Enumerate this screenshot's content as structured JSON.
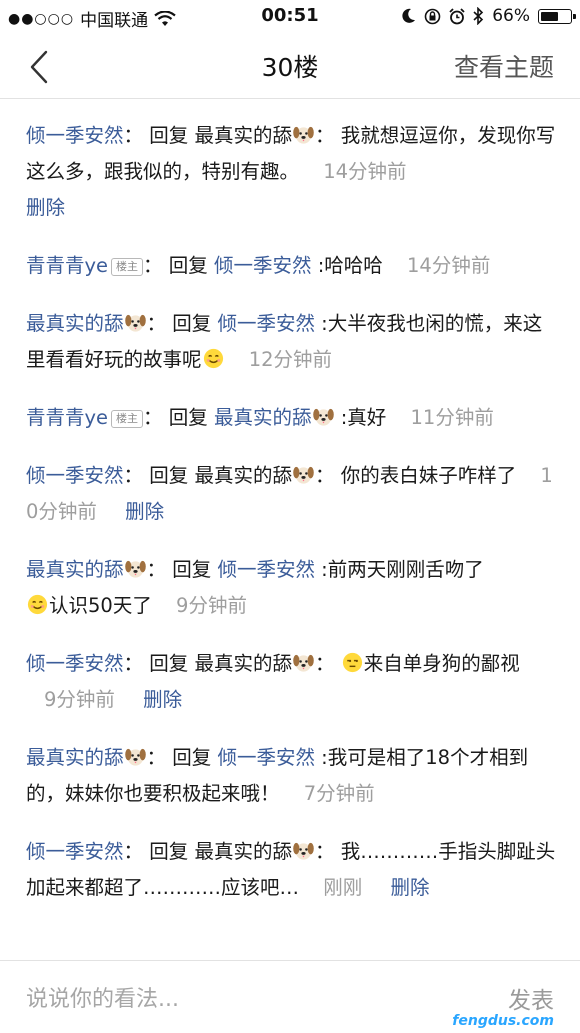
{
  "status_bar": {
    "signal": "●●○○○",
    "carrier": "中国联通",
    "time": "00:51",
    "battery": "66%",
    "battery_level": 0.66
  },
  "nav": {
    "title": "30楼",
    "action": "查看主题"
  },
  "comments": [
    {
      "name": "倾一季安然",
      "name_emoji": "",
      "badge": "",
      "reply_word": "回复",
      "target": "最真实的舔",
      "target_emoji": "dog-face",
      "colon": "：",
      "text": "我就想逗逗你，发现你写这么多，跟我似的，特别有趣。",
      "text_emoji": "",
      "time": "14分钟前",
      "delete": "删除"
    },
    {
      "name": "青青青ye",
      "name_emoji": "",
      "badge": "楼主",
      "reply_word": "回复",
      "target": "倾一季安然",
      "target_emoji": "",
      "colon": ":",
      "text": "哈哈哈",
      "text_emoji": "",
      "time": "14分钟前",
      "delete": ""
    },
    {
      "name": "最真实的舔",
      "name_emoji": "dog-face",
      "badge": "",
      "reply_word": "回复",
      "target": "倾一季安然",
      "target_emoji": "",
      "colon": ":",
      "text": "大半夜我也闲的慌，来这里看看好玩的故事呢",
      "text_emoji": "smiling-face",
      "time": "12分钟前",
      "delete": ""
    },
    {
      "name": "青青青ye",
      "name_emoji": "",
      "badge": "楼主",
      "reply_word": "回复",
      "target": "最真实的舔",
      "target_emoji": "dog-face",
      "colon": ":",
      "text": "真好",
      "text_emoji": "",
      "time": "11分钟前",
      "delete": ""
    },
    {
      "name": "倾一季安然",
      "name_emoji": "",
      "badge": "",
      "reply_word": "回复",
      "target": "最真实的舔",
      "target_emoji": "dog-face",
      "colon": "：",
      "text": "你的表白妹子咋样了",
      "text_emoji": "",
      "time": "10分钟前",
      "delete": "删除"
    },
    {
      "name": "最真实的舔",
      "name_emoji": "dog-face",
      "badge": "",
      "reply_word": "回复",
      "target": "倾一季安然",
      "target_emoji": "",
      "colon": ":",
      "text": "前两天刚刚舌吻了",
      "text_emoji": "smiling-face",
      "text_after": "认识50天了",
      "time": "9分钟前",
      "delete": ""
    },
    {
      "name": "倾一季安然",
      "name_emoji": "",
      "badge": "",
      "reply_word": "回复",
      "target": "最真实的舔",
      "target_emoji": "dog-face",
      "colon": "：",
      "text_emoji_first": "unamused-face",
      "text": "来自单身狗的鄙视",
      "time": "9分钟前",
      "delete": "删除"
    },
    {
      "name": "最真实的舔",
      "name_emoji": "dog-face",
      "badge": "",
      "reply_word": "回复",
      "target": "倾一季安然",
      "target_emoji": "",
      "colon": ":",
      "text": "我可是相了18个才相到的，妹妹你也要积极起来哦！",
      "text_emoji": "",
      "time": "7分钟前",
      "delete": ""
    },
    {
      "name": "倾一季安然",
      "name_emoji": "",
      "badge": "",
      "reply_word": "回复",
      "target": "最真实的舔",
      "target_emoji": "dog-face",
      "colon": "：",
      "text": "我…………手指头脚趾头加起来都超了…………应该吧…",
      "text_emoji": "",
      "time": "刚刚",
      "delete": "删除"
    }
  ],
  "bottom": {
    "input_placeholder": "说说你的看法...",
    "send": "发表",
    "watermark": "fengdus.com"
  },
  "colors": {
    "link": "#3b5c99",
    "time": "#9e9e9e",
    "text": "#1a1a1a"
  }
}
